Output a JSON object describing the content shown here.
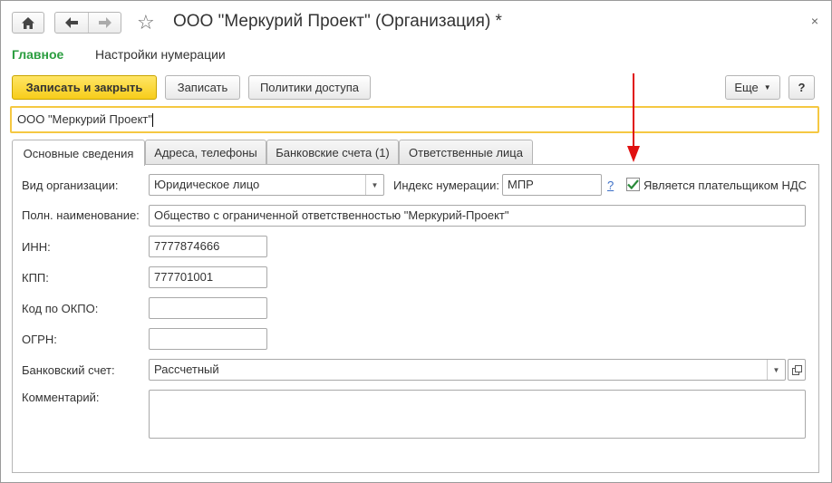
{
  "window": {
    "title": "ООО \"Меркурий Проект\" (Организация) *",
    "close_glyph": "×"
  },
  "sections": {
    "main": "Главное",
    "numbering": "Настройки нумерации"
  },
  "toolbar": {
    "save_close": "Записать и закрыть",
    "save": "Записать",
    "access": "Политики доступа",
    "more": "Еще",
    "help": "?"
  },
  "name_field": {
    "value": "ООО \"Меркурий Проект\""
  },
  "tabs": [
    {
      "label": "Основные сведения",
      "active": true
    },
    {
      "label": "Адреса, телефоны",
      "active": false
    },
    {
      "label": "Банковские счета (1)",
      "active": false
    },
    {
      "label": "Ответственные лица",
      "active": false
    }
  ],
  "form": {
    "org_type": {
      "label": "Вид организации:",
      "value": "Юридическое лицо"
    },
    "num_index": {
      "label": "Индекс нумерации:",
      "value": "МПР",
      "help": "?"
    },
    "vat_payer": {
      "label": "Является плательщиком НДС",
      "checked": true
    },
    "full_name": {
      "label": "Полн. наименование:",
      "value": "Общество с ограниченной ответственностью \"Меркурий-Проект\""
    },
    "inn": {
      "label": "ИНН:",
      "value": "7777874666"
    },
    "kpp": {
      "label": "КПП:",
      "value": "777701001"
    },
    "okpo": {
      "label": "Код по ОКПО:",
      "value": ""
    },
    "ogrn": {
      "label": "ОГРН:",
      "value": ""
    },
    "bank_account": {
      "label": "Банковский счет:",
      "value": "Рассчетный"
    },
    "comment": {
      "label": "Комментарий:",
      "value": ""
    }
  },
  "colors": {
    "accent_green": "#2a9d3f",
    "primary_button": "#f7cd1a",
    "focus_border": "#f5c842",
    "annotation_arrow": "#e01010",
    "link_blue": "#3c6fc7"
  }
}
